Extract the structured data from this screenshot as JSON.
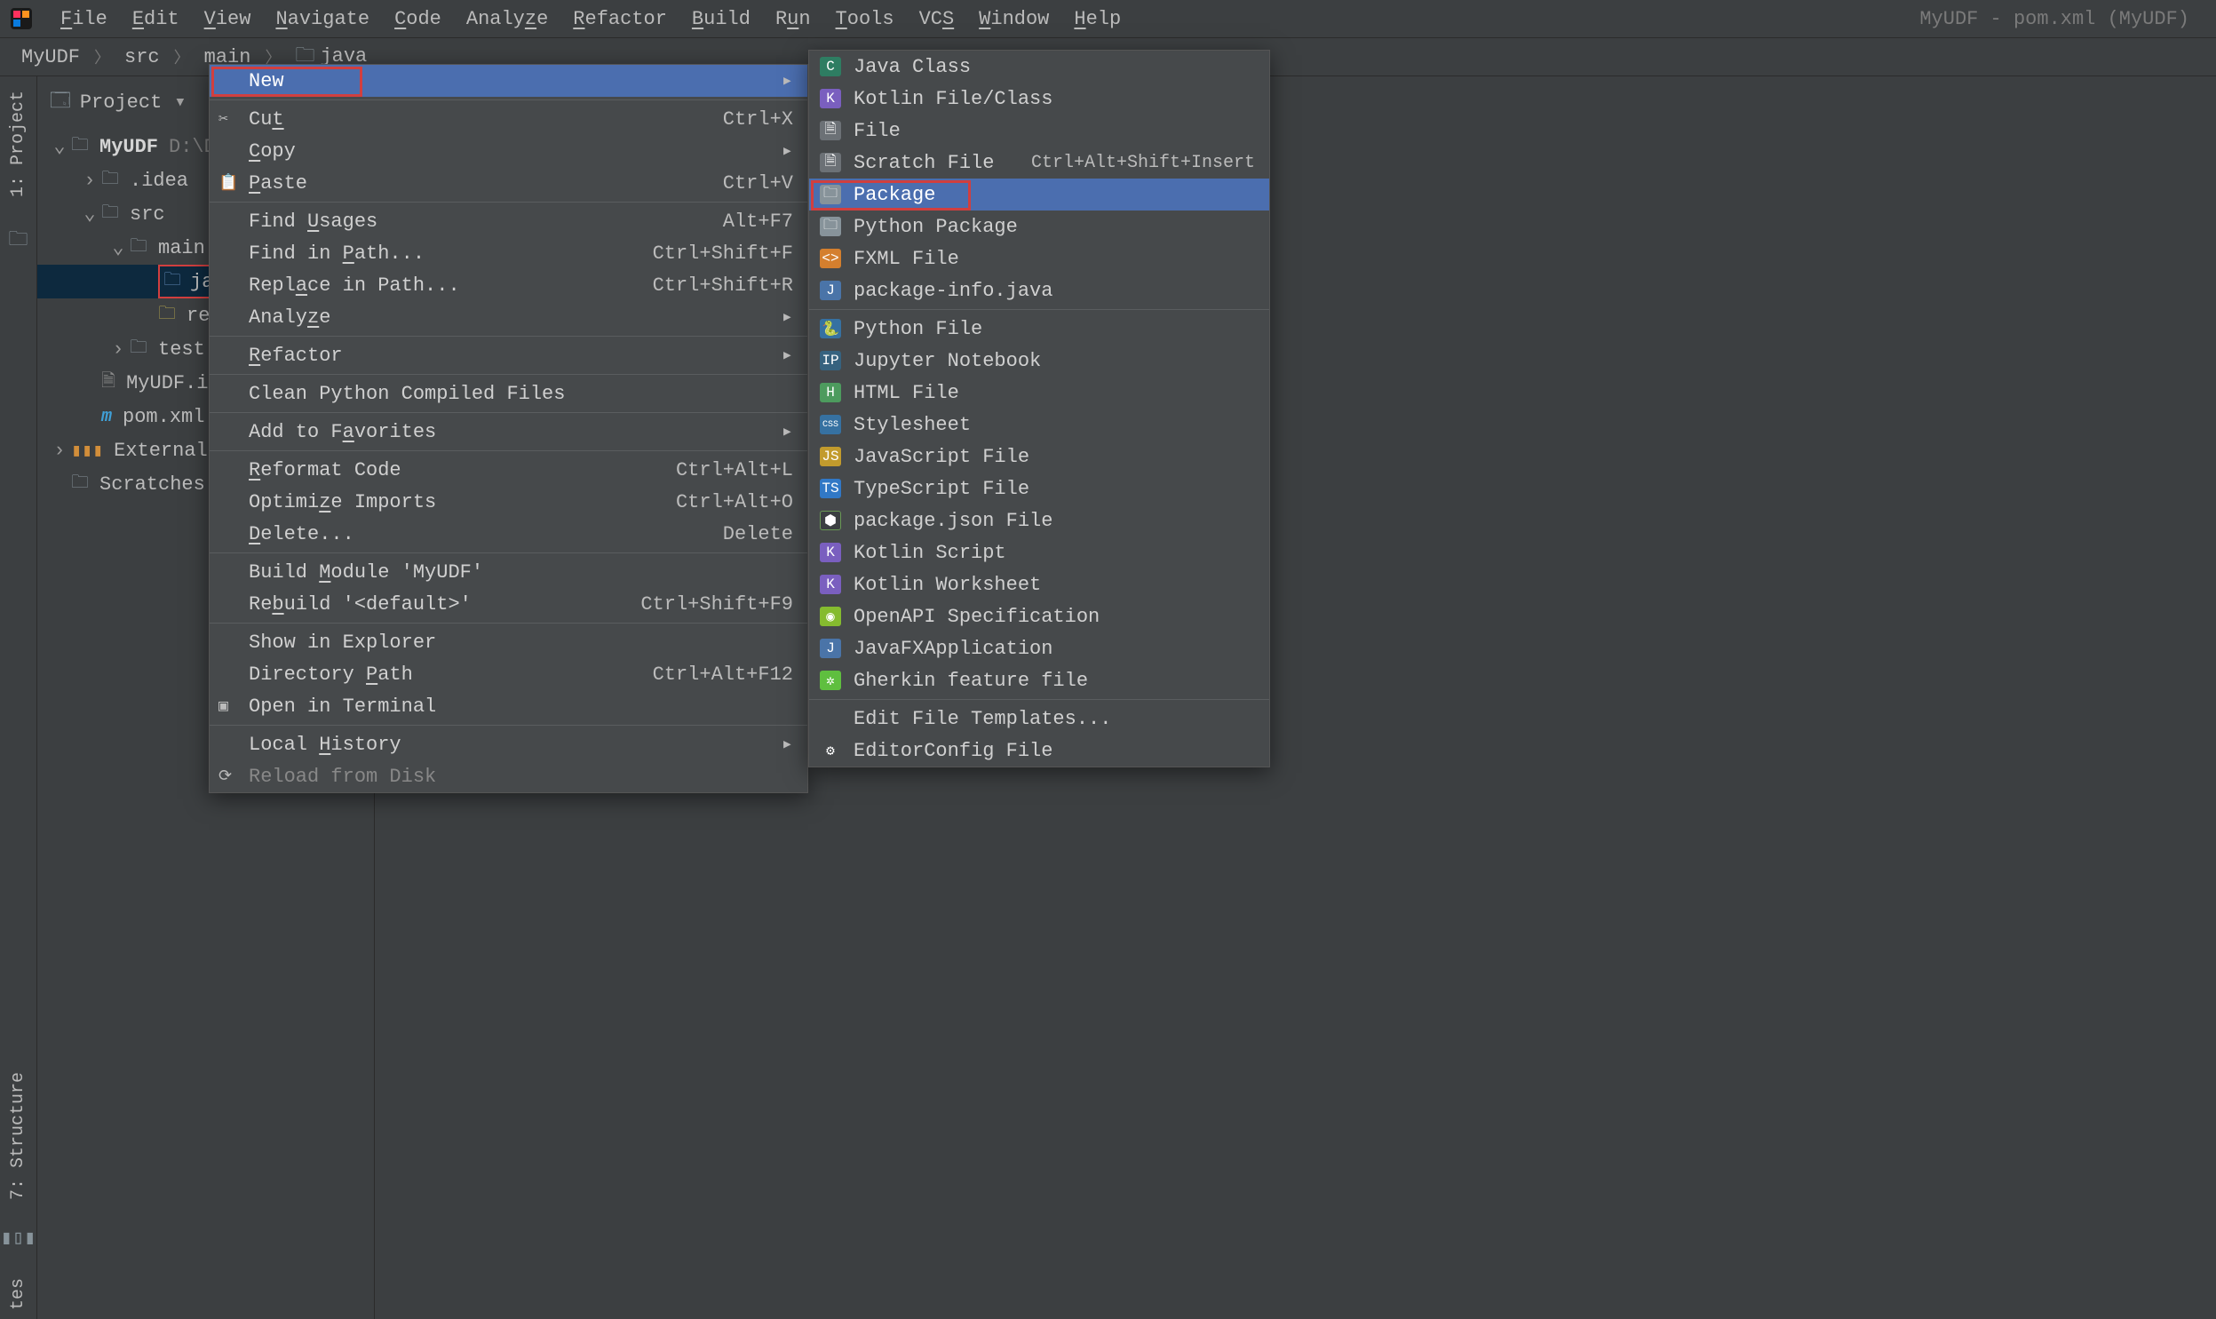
{
  "menubar": {
    "file": "File",
    "edit": "Edit",
    "view": "View",
    "navigate": "Navigate",
    "code": "Code",
    "analyze": "Analyze",
    "refactor": "Refactor",
    "build": "Build",
    "run": "Run",
    "tools": "Tools",
    "vcs": "VCS",
    "window": "Window",
    "help": "Help"
  },
  "title_right": "MyUDF - pom.xml (MyUDF)",
  "breadcrumbs": {
    "p0": "MyUDF",
    "p1": "src",
    "p2": "main",
    "p3": "java"
  },
  "left": {
    "project_tab": "1: Project",
    "structure_tab": "7: Structure",
    "tes_tab": "tes"
  },
  "panel": {
    "title": "Project"
  },
  "tree": {
    "root": "MyUDF",
    "root_path": "D:\\D",
    "idea": ".idea",
    "src": "src",
    "main": "main",
    "java": "ja",
    "resources": "re",
    "test": "test",
    "iml": "MyUDF.im",
    "pom": "pom.xml",
    "external": "External L",
    "scratches": "Scratches"
  },
  "ctx": {
    "new": "New",
    "cut": "Cut",
    "cut_sc": "Ctrl+X",
    "copy": "Copy",
    "paste": "Paste",
    "paste_sc": "Ctrl+V",
    "find_usages": "Find Usages",
    "find_usages_sc": "Alt+F7",
    "find_in_path": "Find in Path...",
    "find_in_path_sc": "Ctrl+Shift+F",
    "replace_in_path": "Replace in Path...",
    "replace_in_path_sc": "Ctrl+Shift+R",
    "analyze": "Analyze",
    "refactor": "Refactor",
    "clean_python": "Clean Python Compiled Files",
    "add_favorites": "Add to Favorites",
    "reformat": "Reformat Code",
    "reformat_sc": "Ctrl+Alt+L",
    "optimize": "Optimize Imports",
    "optimize_sc": "Ctrl+Alt+O",
    "delete": "Delete...",
    "delete_sc": "Delete",
    "build_module": "Build Module 'MyUDF'",
    "rebuild": "Rebuild '<default>'",
    "rebuild_sc": "Ctrl+Shift+F9",
    "show_explorer": "Show in Explorer",
    "dir_path": "Directory Path",
    "dir_path_sc": "Ctrl+Alt+F12",
    "open_terminal": "Open in Terminal",
    "local_history": "Local History",
    "reload": "Reload from Disk"
  },
  "sub": {
    "java_class": "Java Class",
    "kotlin_file": "Kotlin File/Class",
    "file": "File",
    "scratch": "Scratch File",
    "scratch_sc": "Ctrl+Alt+Shift+Insert",
    "package": "Package",
    "python_pkg": "Python Package",
    "fxml": "FXML File",
    "pkg_info": "package-info.java",
    "python_file": "Python File",
    "jupyter": "Jupyter Notebook",
    "html": "HTML File",
    "stylesheet": "Stylesheet",
    "javascript": "JavaScript File",
    "typescript": "TypeScript File",
    "package_json": "package.json File",
    "kotlin_script": "Kotlin Script",
    "kotlin_ws": "Kotlin Worksheet",
    "openapi": "OpenAPI Specification",
    "javafx": "JavaFXApplication",
    "gherkin": "Gherkin feature file",
    "edit_templates": "Edit File Templates...",
    "editorconfig": "EditorConfig File"
  }
}
